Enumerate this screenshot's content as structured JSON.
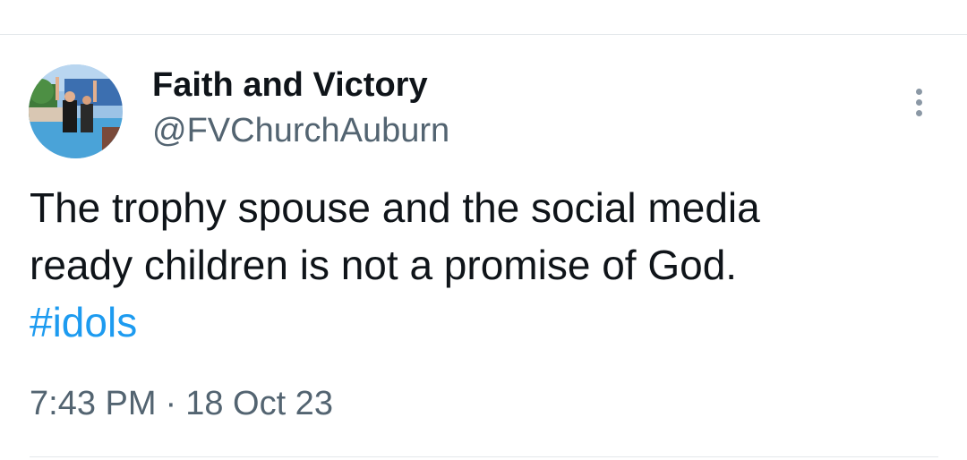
{
  "tweet": {
    "author": {
      "display_name": "Faith and Victory",
      "handle": "@FVChurchAuburn",
      "avatar_icon": "profile-photo"
    },
    "text_lines": [
      "The trophy spouse and the social media",
      "ready children is not a promise of God."
    ],
    "hashtag": "#idols",
    "time": "7:43 PM",
    "separator": "·",
    "date": "18 Oct 23",
    "more_icon": "more-vertical-icon"
  },
  "colors": {
    "text": "#0f1419",
    "secondary": "#536471",
    "link": "#1d9bf0",
    "divider": "#e4e8eb"
  }
}
